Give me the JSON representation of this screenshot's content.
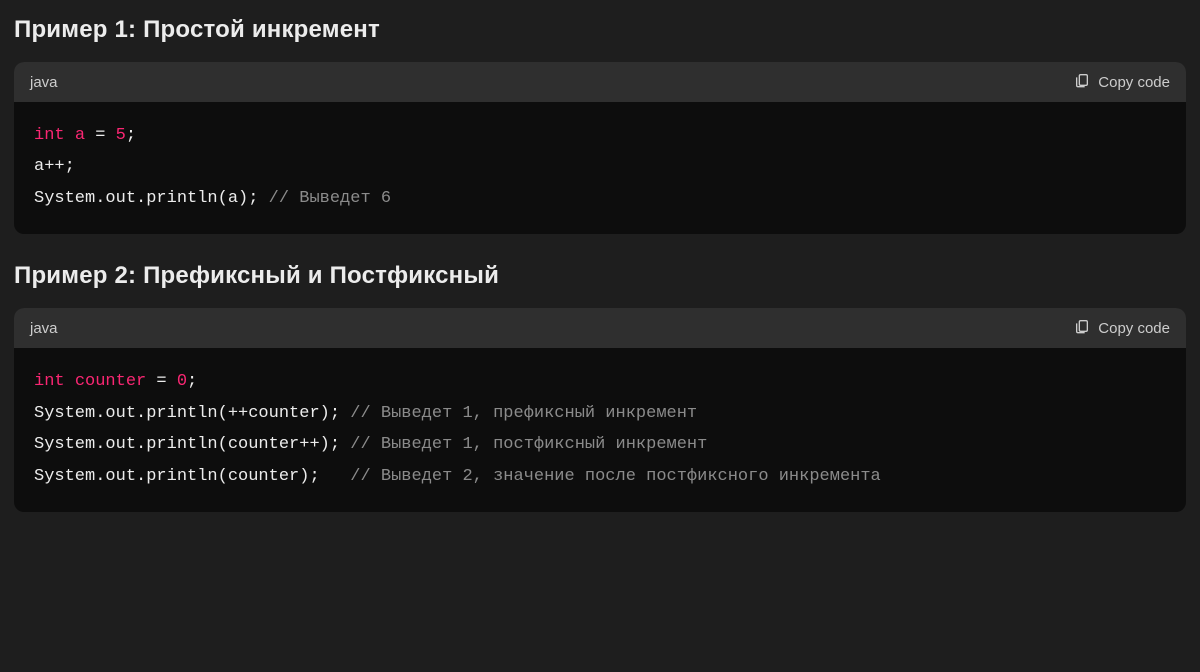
{
  "examples": [
    {
      "heading": "Пример 1: Простой инкремент",
      "language": "java",
      "copy_label": "Copy code",
      "code_lines": [
        [
          {
            "cls": "tok-keyword",
            "text": "int"
          },
          {
            "cls": "tok-text",
            "text": " "
          },
          {
            "cls": "tok-var",
            "text": "a"
          },
          {
            "cls": "tok-text",
            "text": " = "
          },
          {
            "cls": "tok-num",
            "text": "5"
          },
          {
            "cls": "tok-text",
            "text": ";"
          }
        ],
        [
          {
            "cls": "tok-text",
            "text": "a++;"
          }
        ],
        [
          {
            "cls": "tok-text",
            "text": "System.out.println(a); "
          },
          {
            "cls": "tok-comment",
            "text": "// Выведет 6"
          }
        ]
      ]
    },
    {
      "heading": "Пример 2: Префиксный и Постфиксный",
      "language": "java",
      "copy_label": "Copy code",
      "code_lines": [
        [
          {
            "cls": "tok-keyword",
            "text": "int"
          },
          {
            "cls": "tok-text",
            "text": " "
          },
          {
            "cls": "tok-var",
            "text": "counter"
          },
          {
            "cls": "tok-text",
            "text": " = "
          },
          {
            "cls": "tok-num",
            "text": "0"
          },
          {
            "cls": "tok-text",
            "text": ";"
          }
        ],
        [
          {
            "cls": "tok-text",
            "text": "System.out.println(++counter); "
          },
          {
            "cls": "tok-comment",
            "text": "// Выведет 1, префиксный инкремент"
          }
        ],
        [
          {
            "cls": "tok-text",
            "text": "System.out.println(counter++); "
          },
          {
            "cls": "tok-comment",
            "text": "// Выведет 1, постфиксный инкремент"
          }
        ],
        [
          {
            "cls": "tok-text",
            "text": "System.out.println(counter);   "
          },
          {
            "cls": "tok-comment",
            "text": "// Выведет 2, значение после постфиксного инкремента"
          }
        ]
      ]
    }
  ]
}
